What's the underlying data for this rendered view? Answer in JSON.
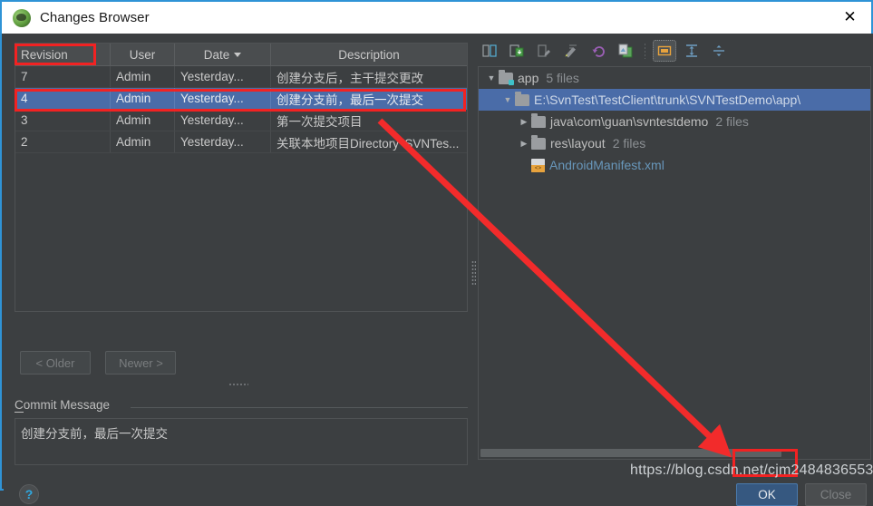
{
  "window": {
    "title": "Changes Browser",
    "icon": "svn-app-icon",
    "close_icon": "close-icon"
  },
  "revision_table": {
    "columns": [
      "Revision",
      "User",
      "Date",
      "Description"
    ],
    "sort_column": "Date",
    "sort_icon": "sort-descending-arrow",
    "rows": [
      {
        "revision": "7",
        "user": "Admin",
        "date": "Yesterday...",
        "description": "创建分支后，主干提交更改",
        "selected": false
      },
      {
        "revision": "4",
        "user": "Admin",
        "date": "Yesterday...",
        "description": "创建分支前，最后一次提交",
        "selected": true
      },
      {
        "revision": "3",
        "user": "Admin",
        "date": "Yesterday...",
        "description": "第一次提交项目",
        "selected": false
      },
      {
        "revision": "2",
        "user": "Admin",
        "date": "Yesterday...",
        "description": "关联本地项目Directory 'SVNTes...",
        "selected": false
      }
    ]
  },
  "nav": {
    "older_label": "< Older",
    "newer_label": "Newer >"
  },
  "commit_message": {
    "label": "Commit Message",
    "value": "创建分支前，最后一次提交"
  },
  "help": {
    "icon": "help-question-icon",
    "glyph": "?"
  },
  "tree_toolbar": {
    "buttons": [
      {
        "name": "show-diff-icon",
        "glyph": "⇄",
        "active": false
      },
      {
        "name": "get-revision-icon",
        "glyph": "⤓",
        "active": false
      },
      {
        "name": "edit-source-icon",
        "glyph": "✎",
        "active": false
      },
      {
        "name": "annotate-icon",
        "glyph": "✍",
        "active": false
      },
      {
        "name": "revert-icon",
        "glyph": "↺",
        "active": false
      },
      {
        "name": "copy-to-clipboard-icon",
        "glyph": "⧉",
        "active": false
      },
      {
        "name": "group-by-directory-icon",
        "glyph": "▣",
        "active": true
      },
      {
        "name": "expand-all-icon",
        "glyph": "⇱",
        "active": false
      },
      {
        "name": "collapse-all-icon",
        "glyph": "⇲",
        "active": false
      }
    ]
  },
  "file_tree": {
    "rows": [
      {
        "indent": 0,
        "twisty": "▼",
        "icon": "module-folder-icon",
        "name": "app",
        "count": "5 files",
        "selected": false,
        "link": false
      },
      {
        "indent": 1,
        "twisty": "▼",
        "icon": "folder-icon",
        "name": "E:\\SvnTest\\TestClient\\trunk\\SVNTestDemo\\app\\",
        "count": "",
        "selected": true,
        "link": true
      },
      {
        "indent": 2,
        "twisty": "▶",
        "icon": "folder-icon",
        "name": "java\\com\\guan\\svntestdemo",
        "count": "2 files",
        "selected": false,
        "link": false
      },
      {
        "indent": 2,
        "twisty": "▶",
        "icon": "folder-icon",
        "name": "res\\layout",
        "count": "2 files",
        "selected": false,
        "link": false
      },
      {
        "indent": 3,
        "twisty": "",
        "icon": "xml-file-icon",
        "name": "AndroidManifest.xml",
        "count": "",
        "selected": false,
        "link": true
      }
    ],
    "hscrollbar": "horizontal-scrollbar"
  },
  "buttons": {
    "ok_label": "OK",
    "close_label": "Close"
  },
  "annotations": {
    "highlight_color": "#f22222",
    "arrow_color": "#f22b2b",
    "watermark": "https://blog.csdn.net/cjm2484836553"
  },
  "colors": {
    "window_bg": "#3c3f41",
    "selection_blue": "#4a6ca8",
    "ok_button_blue": "#365880",
    "link_blue": "#6897bb",
    "border_blue": "#2f93d6"
  }
}
